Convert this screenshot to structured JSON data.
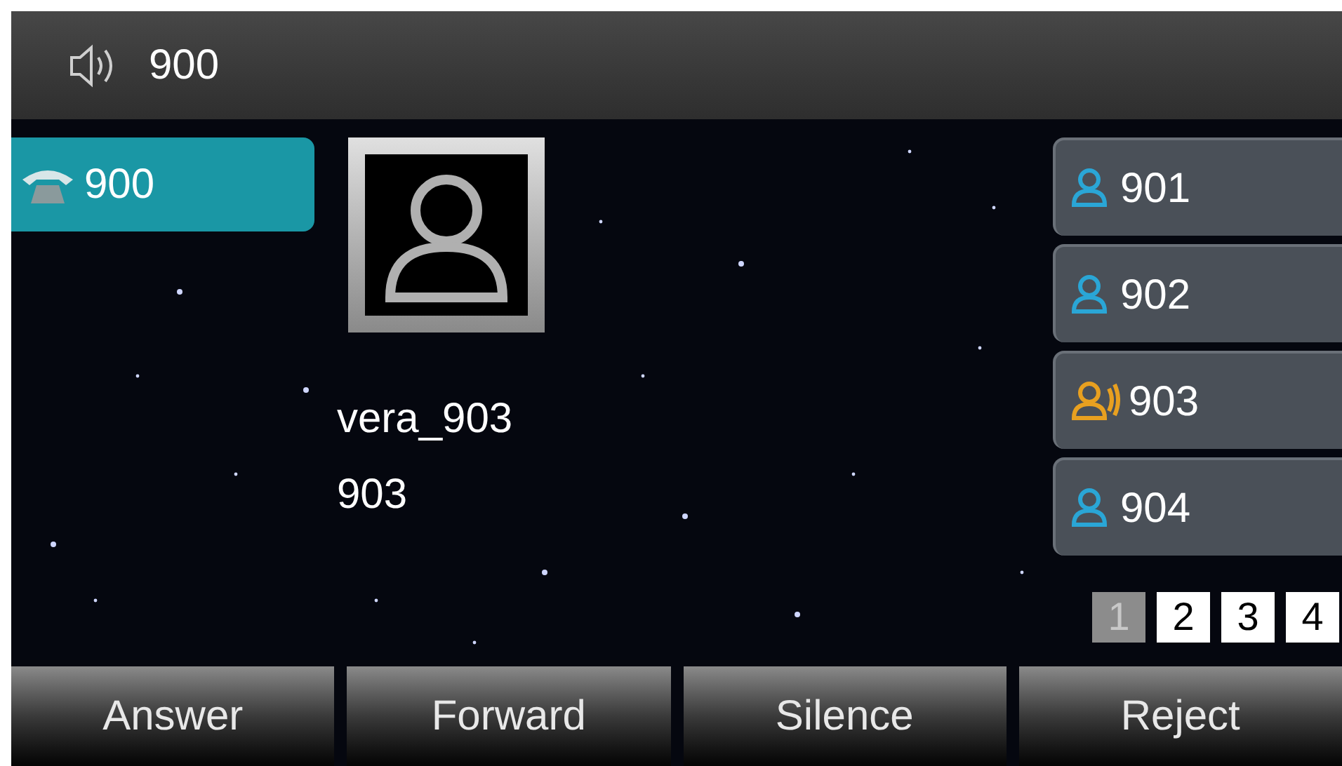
{
  "status_bar": {
    "account": "900"
  },
  "line": {
    "label": "900",
    "selected": true
  },
  "caller": {
    "name": "vera_903",
    "number": "903"
  },
  "dss_keys": [
    {
      "label": "901",
      "kind": "idle"
    },
    {
      "label": "902",
      "kind": "idle"
    },
    {
      "label": "903",
      "kind": "ringing"
    },
    {
      "label": "904",
      "kind": "idle"
    }
  ],
  "pages": [
    {
      "label": "1",
      "selected": true
    },
    {
      "label": "2",
      "selected": false
    },
    {
      "label": "3",
      "selected": false
    },
    {
      "label": "4",
      "selected": false
    }
  ],
  "softkeys": [
    "Answer",
    "Forward",
    "Silence",
    "Reject"
  ]
}
